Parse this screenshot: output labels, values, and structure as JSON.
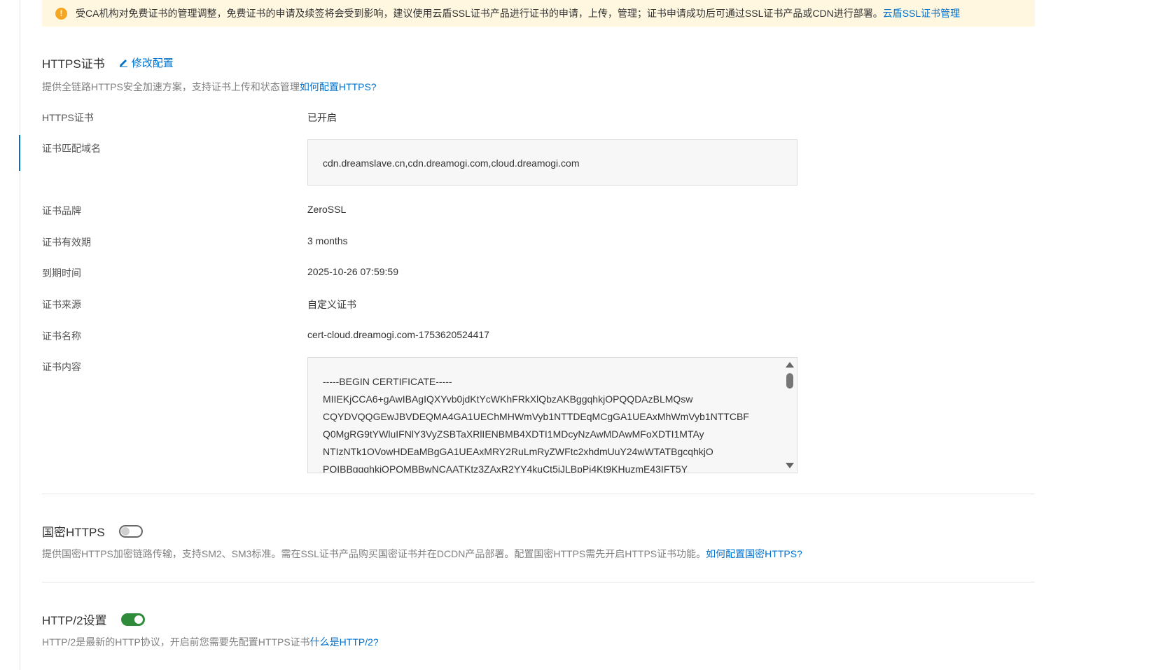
{
  "notice": {
    "icon": "warning-icon",
    "text": "受CA机构对免费证书的管理调整，免费证书的申请及续签将会受到影响，建议使用云盾SSL证书产品进行证书的申请，上传，管理；证书申请成功后可通过SSL证书产品或CDN进行部署。",
    "link": "云盾SSL证书管理"
  },
  "https": {
    "title": "HTTPS证书",
    "edit_label": "修改配置",
    "description": "提供全链路HTTPS安全加速方案，支持证书上传和状态管理",
    "help_link": "如何配置HTTPS?",
    "fields": {
      "status_label": "HTTPS证书",
      "status_value": "已开启",
      "domains_label": "证书匹配域名",
      "domains_value": "cdn.dreamslave.cn,cdn.dreamogi.com,cloud.dreamogi.com",
      "brand_label": "证书品牌",
      "brand_value": "ZeroSSL",
      "validity_label": "证书有效期",
      "validity_value": "3 months",
      "expiry_label": "到期时间",
      "expiry_value": "2025-10-26 07:59:59",
      "source_label": "证书来源",
      "source_value": "自定义证书",
      "name_label": "证书名称",
      "name_value": "cert-cloud.dreamogi.com-1753620524417",
      "content_label": "证书内容",
      "content_value": "-----BEGIN CERTIFICATE-----\nMIIEKjCCA6+gAwIBAgIQXYvb0jdKtYcWKhFRkXlQbzAKBggqhkjOPQQDAzBLMQsw\nCQYDVQQGEwJBVDEQMA4GA1UEChMHWmVyb1NTTDEqMCgGA1UEAxMhWmVyb1NTTCBF\nQ0MgRG9tYWluIFNlY3VyZSBTaXRlIENBMB4XDTI1MDcyNzAwMDAwMFoXDTI1MTAy\nNTIzNTk1OVowHDEaMBgGA1UEAxMRY2RuLmRyZWFtc2xhdmUuY24wWTATBgcqhkjO\nPQIBBggqhkjOPQMBBwNCAATKtz3ZAxR2YY4kuCt5iJLBpPi4Kt9KHuzmE43IFT5Y"
    }
  },
  "guomi": {
    "title": "国密HTTPS",
    "toggle_state": "off",
    "description": "提供国密HTTPS加密链路传输，支持SM2、SM3标准。需在SSL证书产品购买国密证书并在DCDN产品部署。配置国密HTTPS需先开启HTTPS证书功能。",
    "help_link": "如何配置国密HTTPS?"
  },
  "http2": {
    "title": "HTTP/2设置",
    "toggle_state": "on",
    "description": "HTTP/2是最新的HTTP协议，开启前您需要先配置HTTPS证书",
    "help_link": "什么是HTTP/2?"
  },
  "colors": {
    "accent": "#0070cc",
    "notice_bg": "#fff7e0",
    "warning": "#f5a623",
    "toggle_on": "#2e8b3a"
  }
}
